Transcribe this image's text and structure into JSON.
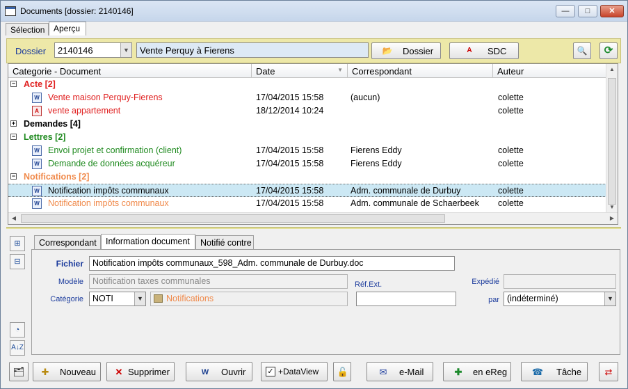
{
  "window": {
    "title": "Documents  [dossier: 2140146]",
    "controls": {
      "minimize": "—",
      "maximize": "□",
      "close": "✕"
    }
  },
  "top_tabs": [
    "Sélection",
    "Aperçu"
  ],
  "dossier_bar": {
    "label": "Dossier",
    "number": "2140146",
    "name": "Vente Perquy à Fierens",
    "dossier_button": "Dossier",
    "sdc_button": "SDC"
  },
  "grid": {
    "columns": [
      "Categorie - Document",
      "Date",
      "Correspondant",
      "Auteur"
    ],
    "groups": [
      {
        "title": "Acte [2]",
        "color": "#e02020",
        "expanded": true,
        "rows": [
          {
            "name": "Vente maison Perquy-Fierens",
            "type": "word",
            "date": "17/04/2015 15:58",
            "correspondent": "(aucun)",
            "author": "colette"
          },
          {
            "name": "vente appartement",
            "type": "pdf",
            "date": "18/12/2014 10:24",
            "correspondent": "",
            "author": "colette"
          }
        ]
      },
      {
        "title": "Demandes [4]",
        "color": "#000000",
        "expanded": false,
        "rows": []
      },
      {
        "title": "Lettres [2]",
        "color": "#1f8a1f",
        "expanded": true,
        "rows": [
          {
            "name": "Envoi projet et confirmation (client)",
            "type": "word",
            "date": "17/04/2015 15:58",
            "correspondent": "Fierens Eddy",
            "author": "colette"
          },
          {
            "name": "Demande de données acquéreur",
            "type": "word",
            "date": "17/04/2015 15:58",
            "correspondent": "Fierens Eddy",
            "author": "colette"
          }
        ]
      },
      {
        "title": "Notifications [2]",
        "color": "#f08a4b",
        "expanded": true,
        "rows": [
          {
            "name": "Notification impôts communaux",
            "type": "word",
            "date": "17/04/2015 15:58",
            "correspondent": "Adm. communale de Durbuy",
            "author": "colette",
            "selected": true
          },
          {
            "name": "Notification impôts communaux",
            "type": "word",
            "date": "17/04/2015 15:58",
            "correspondent": "Adm. communale de Schaerbeek",
            "author": "colette"
          }
        ]
      }
    ]
  },
  "lower_tabs": [
    "Correspondant",
    "Information document",
    "Notifié contre"
  ],
  "info": {
    "fichier_label": "Fichier",
    "fichier_value": "Notification impôts communaux_598_Adm. communale de Durbuy.doc",
    "modele_label": "Modèle",
    "modele_placeholder": "Notification taxes communales",
    "categorie_label": "Catégorie",
    "categorie_value": "NOTI",
    "categorie_name": "Notifications",
    "ref_ext_label": "Réf.Ext.",
    "ref_ext_value": "",
    "expedie_label": "Expédié",
    "par_label": "par",
    "par_value": "(indéterminé)"
  },
  "bottom_buttons": {
    "nouveau": "Nouveau",
    "supprimer": "Supprimer",
    "ouvrir": "Ouvrir",
    "dataview": "+DataView",
    "email": "e-Mail",
    "ereg": "en eReg",
    "tache": "Tâche"
  },
  "colors": {
    "accent_bar": "#ede8a8",
    "selection": "#cce8f4",
    "label_blue": "#1a3a9c"
  }
}
